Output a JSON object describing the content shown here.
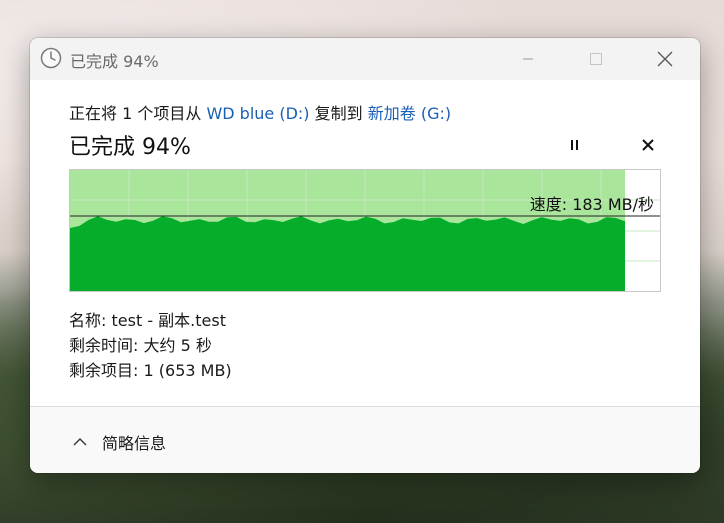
{
  "window": {
    "title": "已完成 94%",
    "icon": "clock-icon"
  },
  "transfer": {
    "prefix": "正在将 1 个项目从 ",
    "source": "WD blue (D:)",
    "middle": " 复制到 ",
    "destination": "新加卷 (G:)"
  },
  "progress": {
    "title": "已完成 94%",
    "percent": 94,
    "speed_label": "速度: 183 MB/秒"
  },
  "buttons": {
    "pause_icon": "pause-icon",
    "cancel_icon": "close-icon"
  },
  "details": {
    "name_label": "名称:",
    "name_value": "test - 副本.test",
    "time_label": "剩余时间:",
    "time_value": "大约 5 秒",
    "items_label": "剩余项目:",
    "items_value": "1 (653 MB)"
  },
  "footer": {
    "collapse_label": "简略信息"
  },
  "colors": {
    "graph_fill": "#05ad2b",
    "graph_done_bg": "#a9e69b",
    "graph_grid": "#c7e8c0",
    "link": "#1a5fb4"
  }
}
